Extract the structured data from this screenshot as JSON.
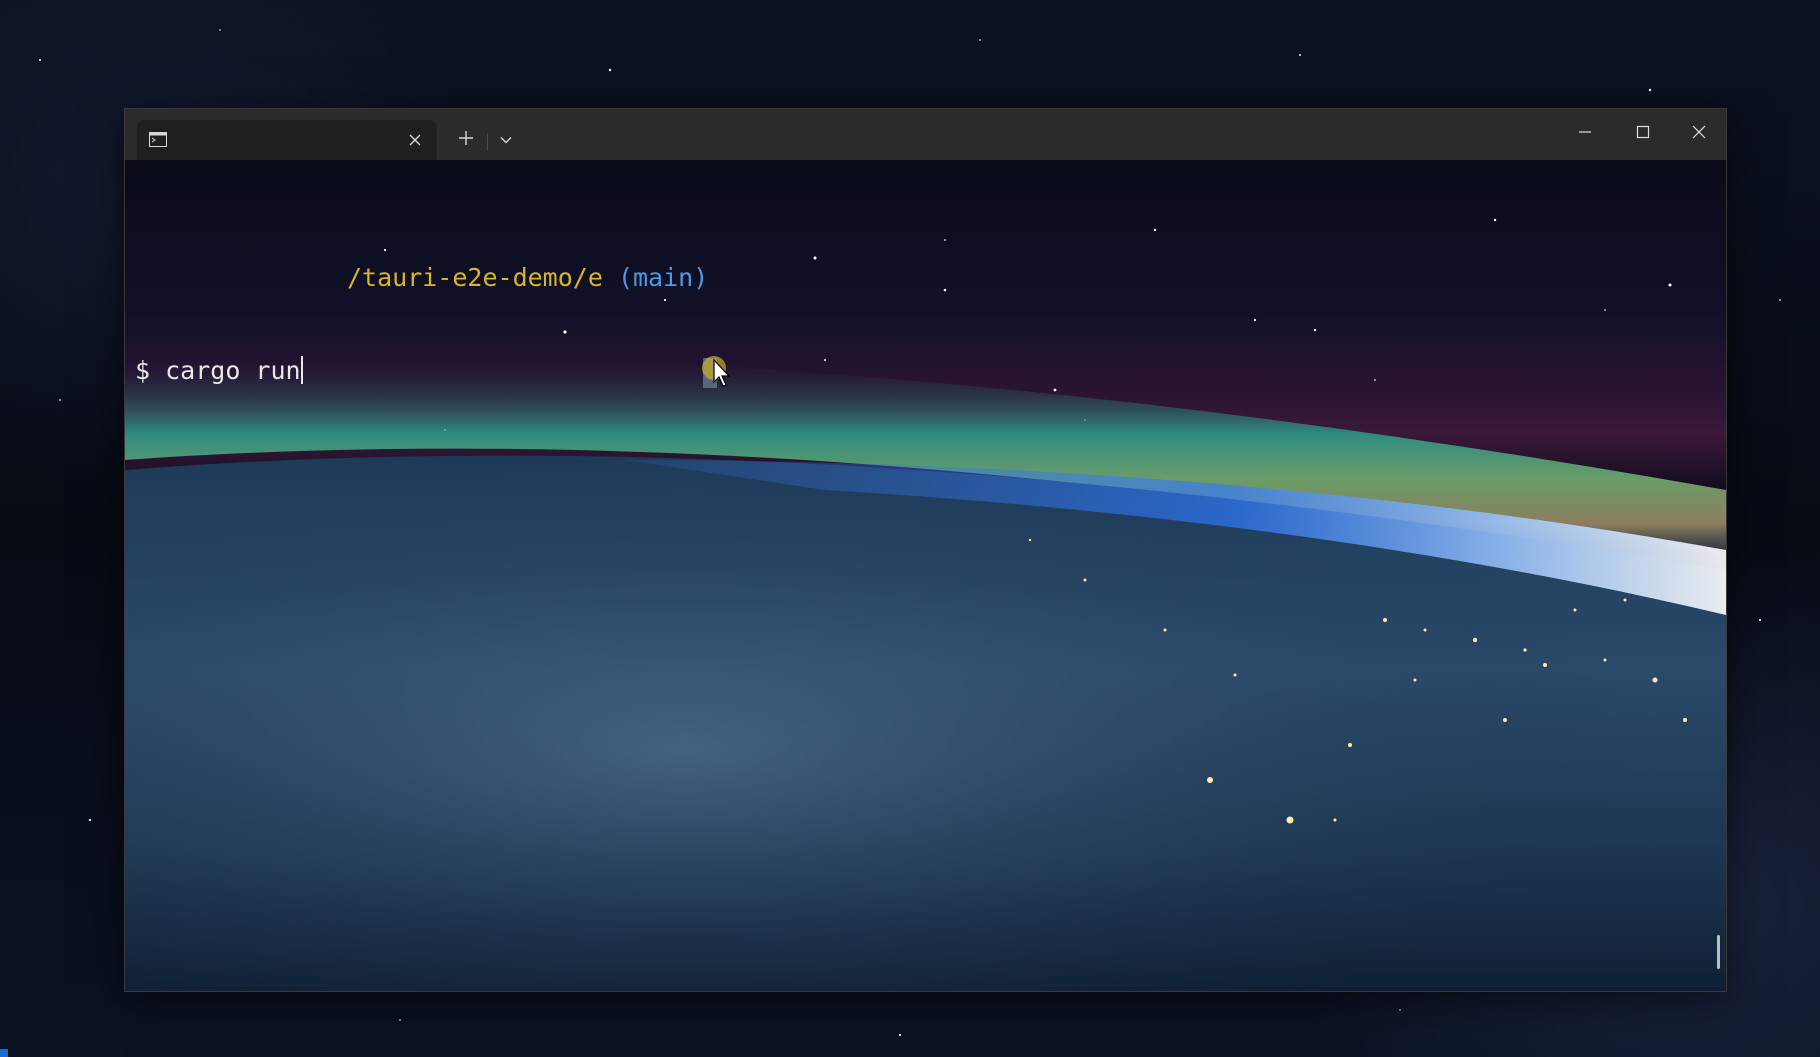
{
  "window": {
    "tab_title": "",
    "icons": {
      "tab": "terminal-icon",
      "tab_close": "close-icon",
      "new_tab": "plus-icon",
      "dropdown": "chevron-down-icon",
      "minimize": "minimize-icon",
      "maximize": "maximize-icon",
      "close": "close-icon"
    }
  },
  "terminal": {
    "path": "/tauri-e2e-demo/",
    "path_end": "e",
    "branch": "(main)",
    "prompt": "$",
    "command": "cargo run"
  },
  "colors": {
    "path": "#d7b52a",
    "branch": "#4a9be6",
    "text": "#e8e8e8",
    "titlebar": "#2b2b2b"
  }
}
